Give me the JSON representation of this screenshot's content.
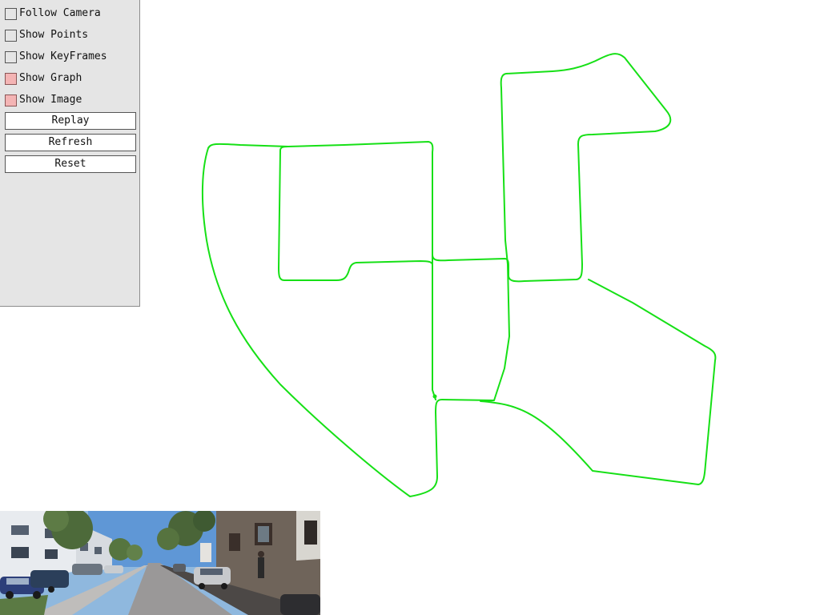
{
  "panel": {
    "checkboxes": [
      {
        "label": "Follow Camera",
        "checked": false
      },
      {
        "label": "Show Points",
        "checked": false
      },
      {
        "label": "Show KeyFrames",
        "checked": false
      },
      {
        "label": "Show Graph",
        "checked": true
      },
      {
        "label": "Show Image",
        "checked": true
      }
    ],
    "buttons": [
      {
        "label": "Replay"
      },
      {
        "label": "Refresh"
      },
      {
        "label": "Reset"
      }
    ]
  },
  "colors": {
    "trajectory": "#16e016",
    "panel_bg": "#e5e5e5",
    "checked_box": "#f4b4b4"
  },
  "icons": {
    "camera_frame": "street-scene-image"
  }
}
